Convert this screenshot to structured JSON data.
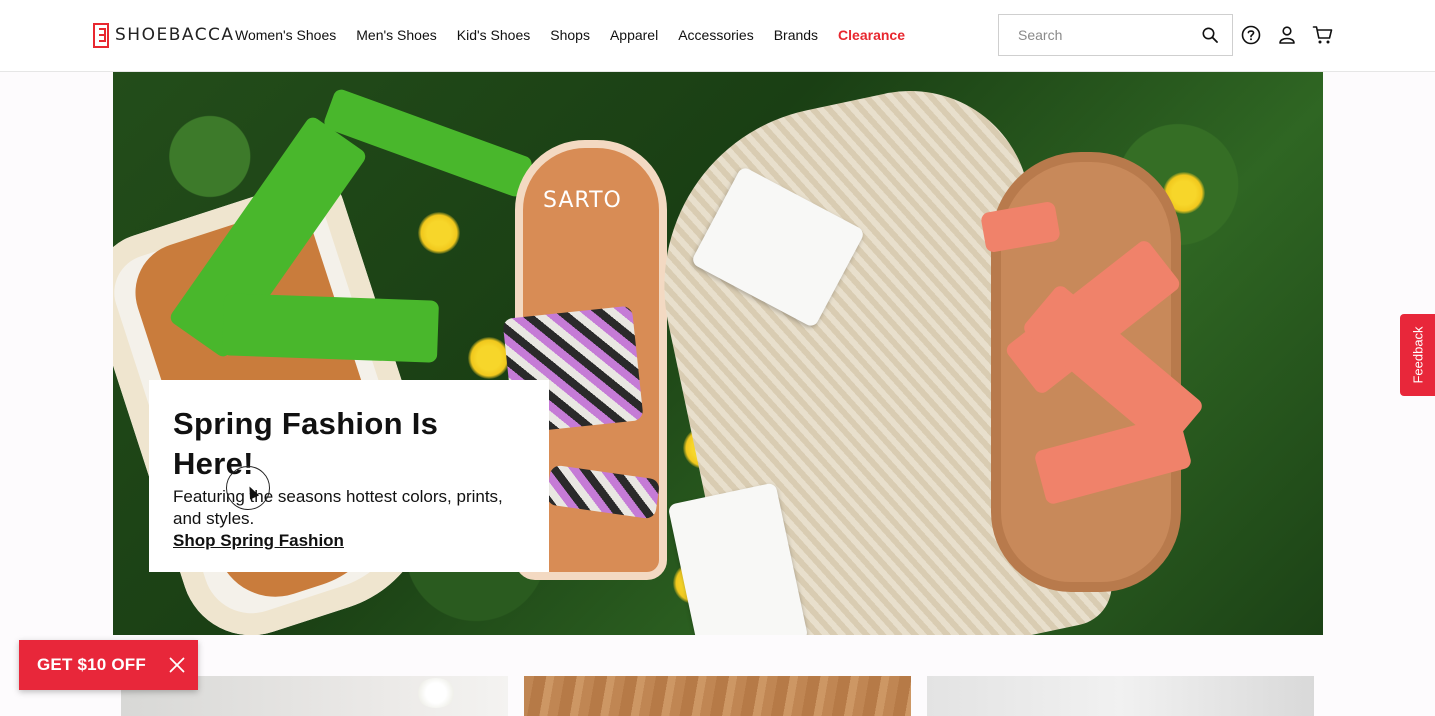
{
  "header": {
    "logo_text": "SHOEBACCA",
    "nav": [
      "Women's Shoes",
      "Men's Shoes",
      "Kid's Shoes",
      "Shops",
      "Apparel",
      "Accessories",
      "Brands",
      "Clearance"
    ],
    "search": {
      "placeholder": "Search",
      "value": ""
    },
    "icons": [
      "help-icon",
      "account-icon",
      "cart-icon"
    ]
  },
  "hero": {
    "title": "Spring Fashion Is Here!",
    "subtitle": "Featuring the seasons hottest colors, prints, and styles.",
    "cta": "Shop Spring Fashion",
    "image_text": "SARTO"
  },
  "feedback_tab": {
    "label": "Feedback"
  },
  "promo": {
    "label": "GET $10 OFF"
  },
  "colors": {
    "brand_red": "#e8272f",
    "promo_red": "#e8273a",
    "text": "#111111"
  }
}
